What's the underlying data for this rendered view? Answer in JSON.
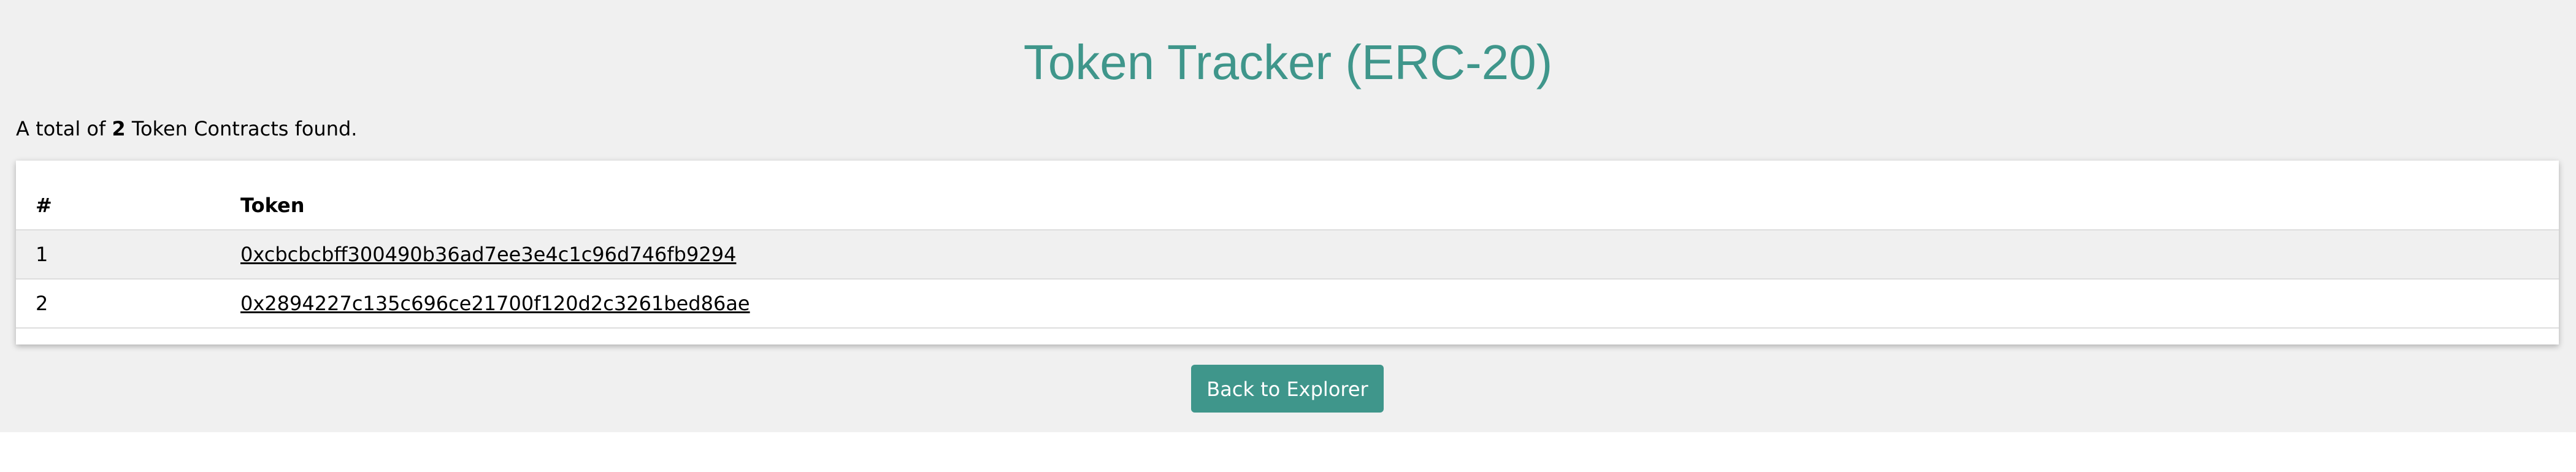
{
  "header": {
    "title": "Token Tracker (ERC-20)"
  },
  "summary": {
    "prefix": "A total of",
    "count": "2",
    "suffix": "Token Contracts found."
  },
  "table": {
    "columns": [
      "#",
      "Token"
    ],
    "rows": [
      {
        "index": "1",
        "token": "0xcbcbcbff300490b36ad7ee3e4c1c96d746fb9294"
      },
      {
        "index": "2",
        "token": "0x2894227c135c696ce21700f120d2c3261bed86ae"
      }
    ]
  },
  "actions": {
    "back_label": "Back to Explorer"
  },
  "colors": {
    "accent": "#3f968b",
    "page_background": "#f0f0f0"
  }
}
